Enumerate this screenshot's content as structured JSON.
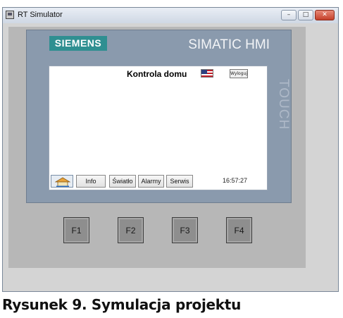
{
  "window": {
    "title": "RT Simulator",
    "controls": {
      "minimize": "–",
      "maximize": "□",
      "close": "✕"
    }
  },
  "device": {
    "brand": "SIEMENS",
    "model": "SIMATIC HMI",
    "touch_label": "TOUCH",
    "function_keys": [
      "F1",
      "F2",
      "F3",
      "F4"
    ]
  },
  "screen": {
    "title": "Kontrola domu",
    "logout_label": "Wyloguj",
    "nav_buttons": [
      "Info",
      "Światło",
      "Alarmy",
      "Serwis"
    ],
    "clock": "16:57:27",
    "icons": {
      "home": "home-icon",
      "flag": "us-flag-icon"
    }
  },
  "caption": "Rysunek 9. Symulacja projektu",
  "colors": {
    "bezel": "#8a9aad",
    "logo_bg": "#2f8f91",
    "device_body": "#b7b7b7",
    "fkey": "#8e8e8e"
  }
}
